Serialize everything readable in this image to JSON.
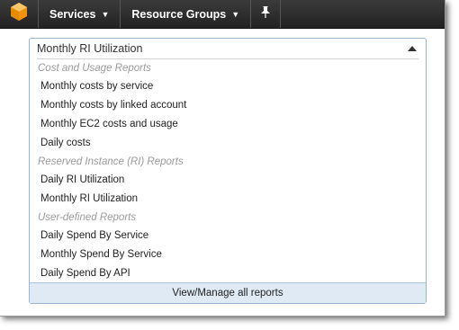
{
  "topbar": {
    "logo": "aws-cube-icon",
    "nav": [
      {
        "label": "Services",
        "icon": "chevron-down-icon"
      },
      {
        "label": "Resource Groups",
        "icon": "chevron-down-icon"
      }
    ],
    "pin_icon": "pushpin-icon"
  },
  "report_select": {
    "selected": "Monthly RI Utilization",
    "caret_icon": "caret-up-icon",
    "groups": [
      {
        "label": "Cost and Usage Reports",
        "options": [
          "Monthly costs by service",
          "Monthly costs by linked account",
          "Monthly EC2 costs and usage",
          "Daily costs"
        ]
      },
      {
        "label": "Reserved Instance (RI) Reports",
        "options": [
          "Daily RI Utilization",
          "Monthly RI Utilization"
        ]
      },
      {
        "label": "User-defined Reports",
        "options": [
          "Daily Spend By Service",
          "Monthly Spend By Service",
          "Daily Spend By API"
        ]
      }
    ],
    "footer_link": "View/Manage all reports"
  },
  "colors": {
    "topbar": "#2b2b2b",
    "logo": "#f7a21b",
    "dropdown_border": "#9ab3cf",
    "footer_bg": "#dfeaf5",
    "group_label": "#9a9a9a"
  }
}
